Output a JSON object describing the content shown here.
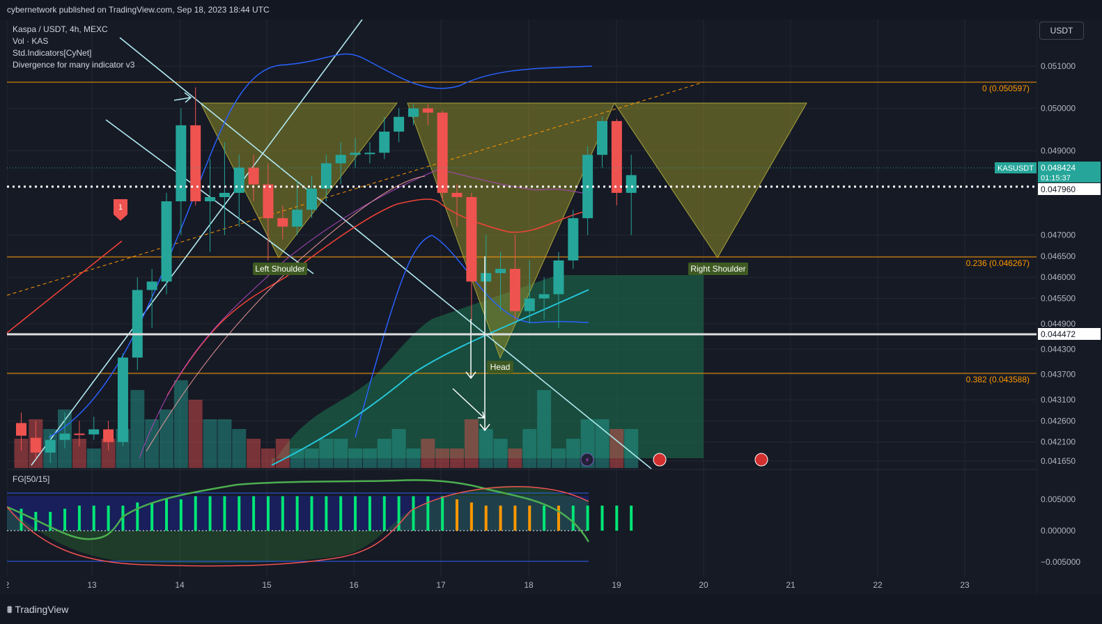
{
  "header": {
    "published": "cybernetwork published on TradingView.com, Sep 18, 2023 18:44 UTC"
  },
  "legend": {
    "symbol": "Kaspa / USDT, 4h, MEXC",
    "volume": "Vol · KAS",
    "indicator1": "Std.Indicators[CyNet]",
    "indicator2": "Divergence for many indicator v3"
  },
  "currency_button": "USDT",
  "footer": {
    "logo": "TradingView"
  },
  "colors": {
    "up": "#26a69a",
    "down": "#ef5350",
    "fib": "#ff9800",
    "pattern": "#8d8a2a",
    "cloud": "#1b5e45"
  },
  "chart_data": {
    "type": "candlestick",
    "x_tick_labels": [
      "2",
      "13",
      "14",
      "15",
      "16",
      "17",
      "18",
      "19",
      "20",
      "21",
      "22",
      "23"
    ],
    "price_axis": [
      "0.051000",
      "0.050000",
      "0.049000",
      "0.047000",
      "0.046500",
      "0.046000",
      "0.045500",
      "0.044900",
      "0.044300",
      "0.043700",
      "0.043100",
      "0.042600",
      "0.042100",
      "0.041650"
    ],
    "last_price": {
      "label": "KASUSDT",
      "value": "0.048424",
      "countdown": "01:15:37"
    },
    "dotted_level": "0.047960",
    "support_level": "0.044472",
    "fib_levels": [
      {
        "label": "0 (0.050597)",
        "value": 0.050597
      },
      {
        "label": "0.236 (0.046267)",
        "value": 0.046267
      },
      {
        "label": "0.382 (0.043588)",
        "value": 0.043588
      }
    ],
    "pattern_labels": [
      "Left Shoulder",
      "Head",
      "Right Shoulder"
    ],
    "marker_label": "1",
    "candles": [
      {
        "o": 0.04255,
        "h": 0.0428,
        "l": 0.0419,
        "c": 0.04225
      },
      {
        "o": 0.0422,
        "h": 0.0426,
        "l": 0.0417,
        "c": 0.04185
      },
      {
        "o": 0.04185,
        "h": 0.0423,
        "l": 0.0416,
        "c": 0.04215
      },
      {
        "o": 0.04215,
        "h": 0.0428,
        "l": 0.04195,
        "c": 0.0423
      },
      {
        "o": 0.0423,
        "h": 0.0426,
        "l": 0.042,
        "c": 0.04228
      },
      {
        "o": 0.04228,
        "h": 0.0427,
        "l": 0.04215,
        "c": 0.0424
      },
      {
        "o": 0.0424,
        "h": 0.0426,
        "l": 0.0419,
        "c": 0.0421
      },
      {
        "o": 0.0421,
        "h": 0.0442,
        "l": 0.042,
        "c": 0.0441
      },
      {
        "o": 0.0441,
        "h": 0.046,
        "l": 0.0438,
        "c": 0.0457
      },
      {
        "o": 0.0457,
        "h": 0.0462,
        "l": 0.0448,
        "c": 0.0459
      },
      {
        "o": 0.0459,
        "h": 0.048,
        "l": 0.0456,
        "c": 0.0478
      },
      {
        "o": 0.0478,
        "h": 0.05,
        "l": 0.047,
        "c": 0.0496
      },
      {
        "o": 0.0496,
        "h": 0.0505,
        "l": 0.0477,
        "c": 0.0478
      },
      {
        "o": 0.0478,
        "h": 0.0488,
        "l": 0.0466,
        "c": 0.0479
      },
      {
        "o": 0.0479,
        "h": 0.0492,
        "l": 0.047,
        "c": 0.048
      },
      {
        "o": 0.048,
        "h": 0.0489,
        "l": 0.0472,
        "c": 0.0486
      },
      {
        "o": 0.0486,
        "h": 0.0489,
        "l": 0.0478,
        "c": 0.0482
      },
      {
        "o": 0.0482,
        "h": 0.0487,
        "l": 0.0464,
        "c": 0.0474
      },
      {
        "o": 0.0474,
        "h": 0.0477,
        "l": 0.0469,
        "c": 0.0472
      },
      {
        "o": 0.0472,
        "h": 0.0483,
        "l": 0.047,
        "c": 0.0476
      },
      {
        "o": 0.0476,
        "h": 0.0484,
        "l": 0.0474,
        "c": 0.0481
      },
      {
        "o": 0.0481,
        "h": 0.0489,
        "l": 0.0478,
        "c": 0.0487
      },
      {
        "o": 0.0487,
        "h": 0.0492,
        "l": 0.0482,
        "c": 0.0489
      },
      {
        "o": 0.0489,
        "h": 0.0493,
        "l": 0.0486,
        "c": 0.04895
      },
      {
        "o": 0.04895,
        "h": 0.0492,
        "l": 0.0487,
        "c": 0.04895
      },
      {
        "o": 0.04895,
        "h": 0.0498,
        "l": 0.0488,
        "c": 0.04945
      },
      {
        "o": 0.04945,
        "h": 0.05,
        "l": 0.0492,
        "c": 0.0498
      },
      {
        "o": 0.0498,
        "h": 0.0501,
        "l": 0.0496,
        "c": 0.05
      },
      {
        "o": 0.05,
        "h": 0.0501,
        "l": 0.0496,
        "c": 0.0499
      },
      {
        "o": 0.0499,
        "h": 0.04995,
        "l": 0.0478,
        "c": 0.048
      },
      {
        "o": 0.048,
        "h": 0.0482,
        "l": 0.0472,
        "c": 0.0479
      },
      {
        "o": 0.0479,
        "h": 0.048,
        "l": 0.045,
        "c": 0.0459
      },
      {
        "o": 0.0459,
        "h": 0.047,
        "l": 0.045,
        "c": 0.0461
      },
      {
        "o": 0.0461,
        "h": 0.0466,
        "l": 0.0452,
        "c": 0.0462
      },
      {
        "o": 0.0462,
        "h": 0.047,
        "l": 0.045,
        "c": 0.0452
      },
      {
        "o": 0.0452,
        "h": 0.0464,
        "l": 0.0449,
        "c": 0.0455
      },
      {
        "o": 0.0455,
        "h": 0.046,
        "l": 0.045,
        "c": 0.0456
      },
      {
        "o": 0.0456,
        "h": 0.0466,
        "l": 0.0448,
        "c": 0.0464
      },
      {
        "o": 0.0464,
        "h": 0.0476,
        "l": 0.0462,
        "c": 0.0474
      },
      {
        "o": 0.0474,
        "h": 0.0491,
        "l": 0.047,
        "c": 0.0489
      },
      {
        "o": 0.0489,
        "h": 0.0498,
        "l": 0.0486,
        "c": 0.0497
      },
      {
        "o": 0.0497,
        "h": 0.04975,
        "l": 0.0477,
        "c": 0.048
      },
      {
        "o": 0.048,
        "h": 0.0489,
        "l": 0.047,
        "c": 0.04842
      }
    ],
    "volumes": [
      3,
      5,
      4,
      6,
      3,
      2,
      3,
      4,
      8,
      5,
      6,
      9,
      7,
      5,
      5,
      4,
      3,
      2,
      3,
      2,
      2,
      3,
      3,
      2,
      2,
      3,
      4,
      2,
      3,
      2,
      2,
      5,
      4,
      3,
      2,
      4,
      8,
      2,
      3,
      5,
      5,
      4,
      4
    ],
    "oscillator": {
      "label": "FG[50/15]",
      "axis": [
        "0.005000",
        "0.000000",
        "−0.005000"
      ],
      "histogram": [
        0.0035,
        0.003,
        0.003,
        0.0035,
        0.004,
        0.004,
        0.004,
        0.004,
        0.0045,
        0.0045,
        0.005,
        0.005,
        0.0055,
        0.0055,
        0.0055,
        0.0055,
        0.0055,
        0.0055,
        0.0055,
        0.0055,
        0.0055,
        0.0055,
        0.0055,
        0.0055,
        0.0055,
        0.0055,
        0.0055,
        0.0055,
        0.0055,
        0.0055,
        0.005,
        0.0045,
        0.004,
        0.004,
        0.004,
        0.004,
        0.004,
        0.004,
        0.004,
        0.004,
        0.004,
        0.004,
        0.004
      ],
      "hist_colors": [
        "g",
        "g",
        "g",
        "g",
        "g",
        "g",
        "g",
        "g",
        "g",
        "g",
        "g",
        "g",
        "g",
        "g",
        "g",
        "g",
        "g",
        "g",
        "g",
        "g",
        "g",
        "g",
        "g",
        "g",
        "g",
        "g",
        "g",
        "g",
        "g",
        "g",
        "o",
        "o",
        "o",
        "o",
        "o",
        "o",
        "g",
        "o",
        "g",
        "g",
        "g",
        "g",
        "g"
      ]
    }
  }
}
